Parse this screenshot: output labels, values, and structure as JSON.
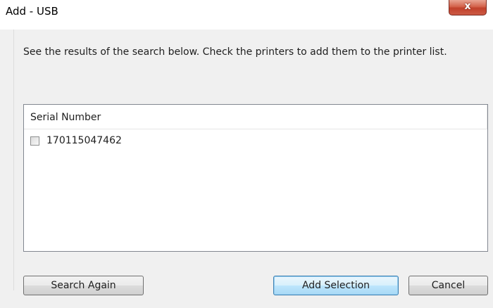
{
  "window": {
    "title": "Add - USB",
    "close_glyph": "x"
  },
  "instruction": "See the results of the search below. Check the printers to add them to the printer list.",
  "list": {
    "columns": [
      "Serial Number"
    ],
    "rows": [
      {
        "serial": "170115047462",
        "checked": false
      }
    ]
  },
  "buttons": {
    "search_again": "Search Again",
    "add_selection": "Add Selection",
    "cancel": "Cancel"
  },
  "icons": {
    "close": "close-icon",
    "checkbox": "checkbox-unchecked"
  },
  "colors": {
    "close_button": "#c1412b",
    "default_button_border": "#3c7fb1",
    "dialog_background": "#f0f0f0"
  }
}
